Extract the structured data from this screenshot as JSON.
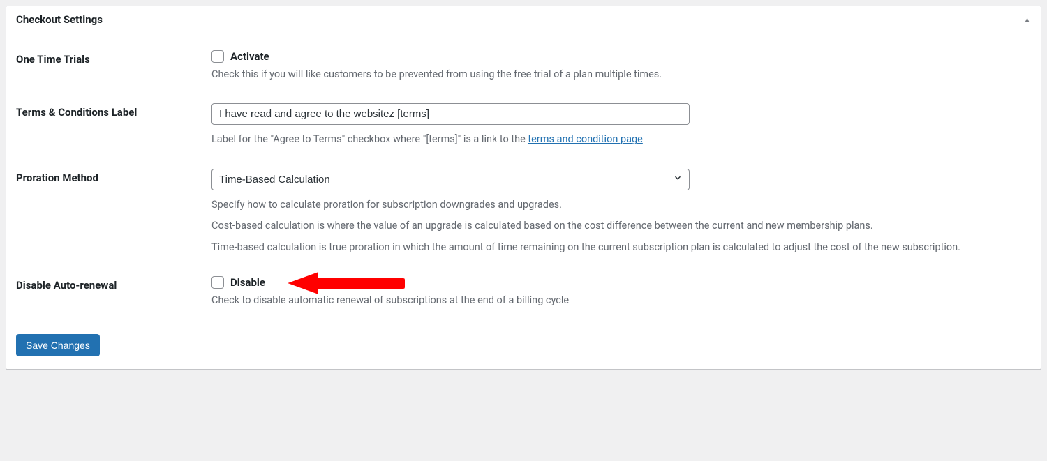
{
  "panel": {
    "title": "Checkout Settings"
  },
  "rows": {
    "one_time_trials": {
      "label": "One Time Trials",
      "checkbox_label": "Activate",
      "help": "Check this if you will like customers to be prevented from using the free trial of a plan multiple times."
    },
    "terms": {
      "label": "Terms & Conditions Label",
      "input_value": "I have read and agree to the websitez [terms]",
      "help_prefix": "Label for the \"Agree to Terms\" checkbox where \"[terms]\" is a link to the ",
      "help_link": "terms and condition page"
    },
    "proration": {
      "label": "Proration Method",
      "selected": "Time-Based Calculation",
      "help1": "Specify how to calculate proration for subscription downgrades and upgrades.",
      "help2": "Cost-based calculation is where the value of an upgrade is calculated based on the cost difference between the current and new membership plans.",
      "help3": "Time-based calculation is true proration in which the amount of time remaining on the current subscription plan is calculated to adjust the cost of the new subscription."
    },
    "auto_renewal": {
      "label": "Disable Auto-renewal",
      "checkbox_label": "Disable",
      "help": "Check to disable automatic renewal of subscriptions at the end of a billing cycle"
    }
  },
  "save_button": "Save Changes"
}
